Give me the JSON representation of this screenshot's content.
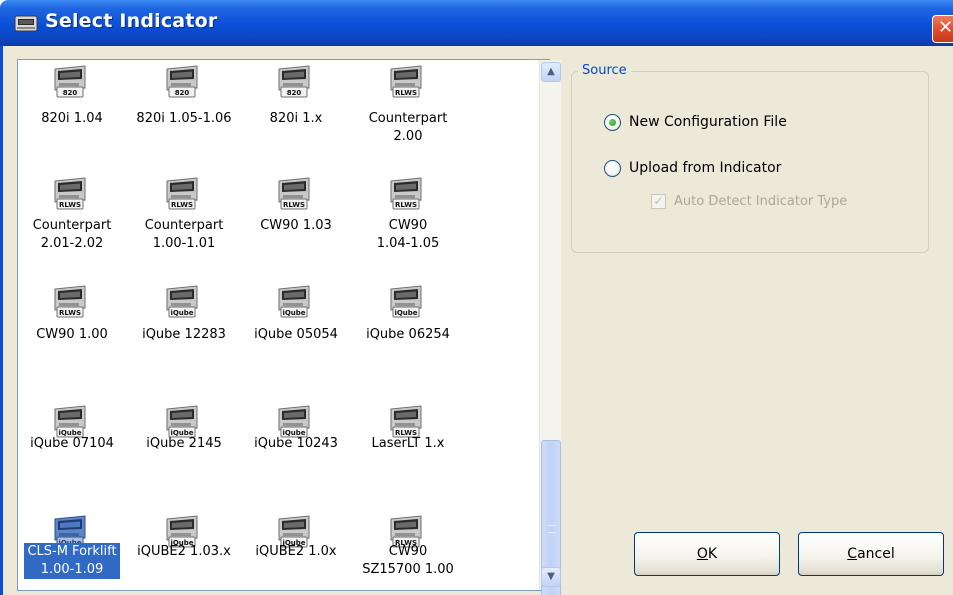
{
  "window": {
    "title": "Select Indicator",
    "close_glyph": "✕",
    "title_icon": "indicator-app-icon"
  },
  "indicators": [
    {
      "label": "820i 1.04",
      "badge": "820",
      "selected": false
    },
    {
      "label": "820i 1.05-1.06",
      "badge": "820",
      "selected": false
    },
    {
      "label": "820i 1.x",
      "badge": "820",
      "selected": false
    },
    {
      "label": "Counterpart 2.00",
      "badge": "RLWS",
      "selected": false
    },
    {
      "label": "Counterpart 2.01-2.02",
      "badge": "RLWS",
      "selected": false
    },
    {
      "label": "Counterpart 1.00-1.01",
      "badge": "RLWS",
      "selected": false
    },
    {
      "label": "CW90 1.03",
      "badge": "RLWS",
      "selected": false
    },
    {
      "label": "CW90 1.04-1.05",
      "badge": "RLWS",
      "selected": false
    },
    {
      "label": "CW90 1.00",
      "badge": "RLWS",
      "selected": false
    },
    {
      "label": "iQube 12283",
      "badge": "iQube",
      "selected": false
    },
    {
      "label": "iQube 05054",
      "badge": "iQube",
      "selected": false
    },
    {
      "label": "iQube 06254",
      "badge": "iQube",
      "selected": false
    },
    {
      "label": "iQube 07104",
      "badge": "iQube",
      "selected": false
    },
    {
      "label": "iQube 2145",
      "badge": "iQube",
      "selected": false
    },
    {
      "label": "iQube 10243",
      "badge": "iQube",
      "selected": false
    },
    {
      "label": "LaserLT 1.x",
      "badge": "RLWS",
      "selected": false
    },
    {
      "label": "CLS-M Forklift 1.00-1.09",
      "badge": "iQube",
      "selected": true
    },
    {
      "label": "iQUBE2 1.03.x",
      "badge": "iQube",
      "selected": false
    },
    {
      "label": "iQUBE2 1.0x",
      "badge": "iQube",
      "selected": false
    },
    {
      "label": "CW90 SZ15700 1.00",
      "badge": "RLWS",
      "selected": false
    }
  ],
  "labels_display": [
    [
      "820i 1.04"
    ],
    [
      "820i 1.05-1.06"
    ],
    [
      "820i 1.x"
    ],
    [
      "Counterpart",
      "2.00"
    ],
    [
      "Counterpart",
      "2.01-2.02"
    ],
    [
      "Counterpart",
      "1.00-1.01"
    ],
    [
      "CW90 1.03"
    ],
    [
      "CW90",
      "1.04-1.05"
    ],
    [
      "CW90 1.00"
    ],
    [
      "iQube 12283"
    ],
    [
      "iQube 05054"
    ],
    [
      "iQube 06254"
    ],
    [
      "iQube 07104"
    ],
    [
      "iQube 2145"
    ],
    [
      "iQube 10243"
    ],
    [
      "LaserLT 1.x"
    ],
    [
      "CLS-M Forklift",
      "1.00-1.09"
    ],
    [
      "iQUBE2 1.03.x"
    ],
    [
      "iQUBE2 1.0x"
    ],
    [
      "CW90",
      "SZ15700 1.00"
    ]
  ],
  "scrollbar": {
    "up_glyph": "▲",
    "down_glyph": "▼"
  },
  "source": {
    "legend": "Source",
    "new_config_label": "New Configuration File",
    "new_config_checked": true,
    "upload_label": "Upload from Indicator",
    "upload_checked": false,
    "auto_detect_label": "Auto Detect Indicator Type",
    "auto_detect_checked": true,
    "auto_detect_enabled": false,
    "check_glyph": "✓"
  },
  "buttons": {
    "ok": "OK",
    "cancel": "Cancel"
  },
  "colors": {
    "selection": "#316ac5",
    "title_bar": "#0a4fd6",
    "legend": "#0046d5"
  }
}
